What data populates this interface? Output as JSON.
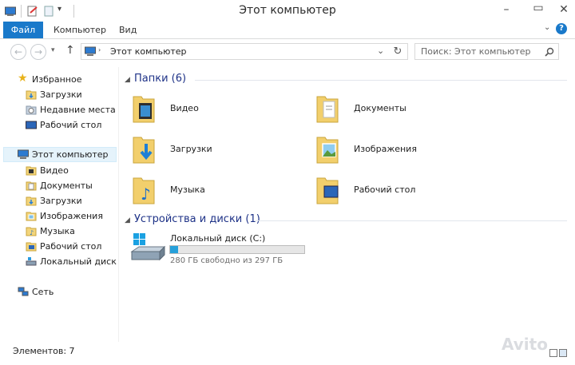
{
  "window": {
    "title": "Этот компьютер"
  },
  "ribbon": {
    "tabs": [
      "Файл",
      "Компьютер",
      "Вид"
    ]
  },
  "address": {
    "path": "Этот компьютер",
    "search_placeholder": "Поиск: Этот компьютер"
  },
  "nav": {
    "favorites": {
      "label": "Избранное",
      "items": [
        "Загрузки",
        "Недавние места",
        "Рабочий стол"
      ]
    },
    "computer": {
      "label": "Этот компьютер",
      "items": [
        "Видео",
        "Документы",
        "Загрузки",
        "Изображения",
        "Музыка",
        "Рабочий стол",
        "Локальный диск (C"
      ]
    },
    "network": {
      "label": "Сеть"
    }
  },
  "content": {
    "folders_header": "Папки (6)",
    "folders": [
      "Видео",
      "Документы",
      "Загрузки",
      "Изображения",
      "Музыка",
      "Рабочий стол"
    ],
    "drives_header": "Устройства и диски (1)",
    "drive": {
      "name": "Локальный диск (C:)",
      "free_text": "280 ГБ свободно из 297 ГБ",
      "used_fraction": 0.057
    }
  },
  "status": {
    "items_text": "Элементов: 7"
  },
  "watermark": "Avito",
  "colors": {
    "accent": "#1979ca",
    "header": "#1e3287",
    "drive_bar": "#26a0da"
  }
}
